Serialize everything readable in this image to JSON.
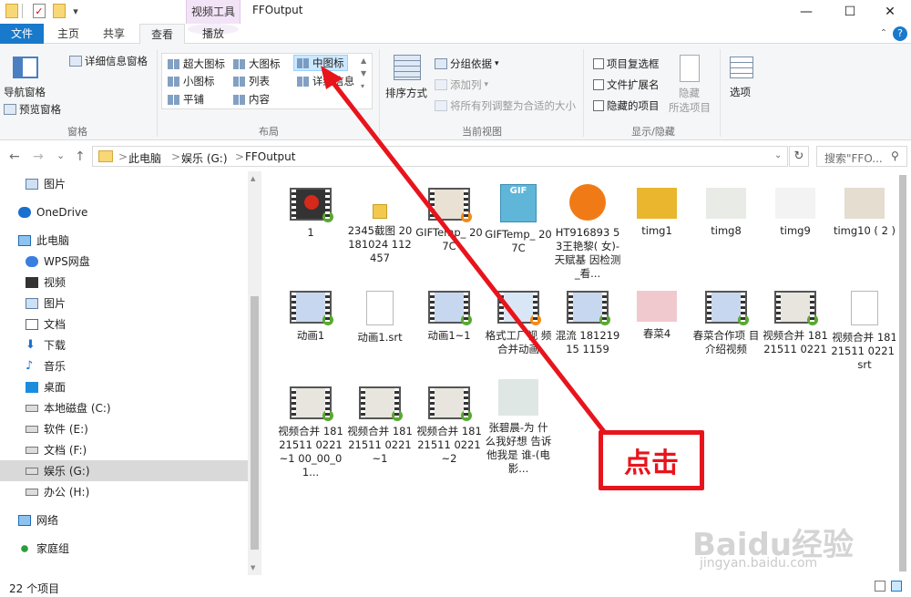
{
  "titlebar": {
    "context_tab": "视频工具",
    "window_title": "FFOutput",
    "minimize": "—",
    "maximize": "☐",
    "close": "✕"
  },
  "tabs": [
    {
      "label": "文件"
    },
    {
      "label": "主页"
    },
    {
      "label": "共享"
    },
    {
      "label": "查看"
    },
    {
      "label": "播放"
    }
  ],
  "ribbon": {
    "panes": {
      "nav_pane": "导航窗格",
      "preview_pane": "预览窗格",
      "details_pane": "详细信息窗格",
      "group_label": "窗格"
    },
    "layout": {
      "items": [
        "超大图标",
        "大图标",
        "中图标",
        "小图标",
        "列表",
        "详细信息",
        "平铺",
        "内容"
      ],
      "selected": "中图标",
      "group_label": "布局"
    },
    "current_view": {
      "sort_by": "排序方式",
      "group_by": "分组依据",
      "add_column": "添加列",
      "fit_columns": "将所有列调整为合适的大小",
      "group_label": "当前视图"
    },
    "show_hide": {
      "item_checkboxes": "项目复选框",
      "file_extensions": "文件扩展名",
      "hidden_items": "隐藏的项目",
      "hide_selected": "隐藏",
      "hide_selected_2": "所选项目",
      "group_label": "显示/隐藏"
    },
    "options": "选项"
  },
  "address": {
    "back": "←",
    "forward": "→",
    "recent": "⌄",
    "up": "↑",
    "crumbs": [
      "此电脑",
      "娱乐 (G:)",
      "FFOutput"
    ],
    "refresh": "↻",
    "search_placeholder": "搜索\"FFO...",
    "sep": ">"
  },
  "nav": [
    {
      "label": "图片"
    },
    {
      "label": "OneDrive"
    },
    {
      "label": "此电脑"
    },
    {
      "label": "WPS网盘"
    },
    {
      "label": "视频"
    },
    {
      "label": "图片"
    },
    {
      "label": "文档"
    },
    {
      "label": "下载"
    },
    {
      "label": "音乐"
    },
    {
      "label": "桌面"
    },
    {
      "label": "本地磁盘 (C:)"
    },
    {
      "label": "软件 (E:)"
    },
    {
      "label": "文档 (F:)"
    },
    {
      "label": "娱乐 (G:)"
    },
    {
      "label": "办公 (H:)"
    },
    {
      "label": "网络"
    },
    {
      "label": "家庭组"
    }
  ],
  "files": [
    {
      "name": "1",
      "kind": "video"
    },
    {
      "name": "2345截图 20181024 112457",
      "kind": "image-icon"
    },
    {
      "name": "GIFTemp_ 207C",
      "kind": "video-orange"
    },
    {
      "name": "GIFTemp_ 207C",
      "kind": "gif"
    },
    {
      "name": "HT916893 53王艳黎( 女)-天赋基 因检测_看...",
      "kind": "app"
    },
    {
      "name": "timg1",
      "kind": "photo"
    },
    {
      "name": "timg8",
      "kind": "photo"
    },
    {
      "name": "timg9",
      "kind": "photo"
    },
    {
      "name": "timg10 ( 2 )",
      "kind": "photo"
    },
    {
      "name": "动画1",
      "kind": "video"
    },
    {
      "name": "动画1.srt",
      "kind": "doc"
    },
    {
      "name": "动画1~1",
      "kind": "video"
    },
    {
      "name": "格式工厂视 频合并动画",
      "kind": "video-orange"
    },
    {
      "name": "混流 18121915 1159",
      "kind": "video"
    },
    {
      "name": "春菜4",
      "kind": "photo"
    },
    {
      "name": "春菜合作项 目介绍视频",
      "kind": "video"
    },
    {
      "name": "视频合并 18121511 0221",
      "kind": "video"
    },
    {
      "name": "视频合并 18121511 0221.srt",
      "kind": "doc"
    },
    {
      "name": "视频合并 18121511 0221~1 00_00_01...",
      "kind": "video"
    },
    {
      "name": "视频合并 18121511 0221~1",
      "kind": "video"
    },
    {
      "name": "视频合并 18121511 0221~2",
      "kind": "video"
    },
    {
      "name": "张碧晨-为 什么我好想 告诉他我是 谁-(电影...",
      "kind": "photo"
    }
  ],
  "status": {
    "count": "22 个项目"
  },
  "annotation": {
    "callout": "点击",
    "watermark": "Baidu经验",
    "watermark_sub": "jingyan.baidu.com"
  }
}
